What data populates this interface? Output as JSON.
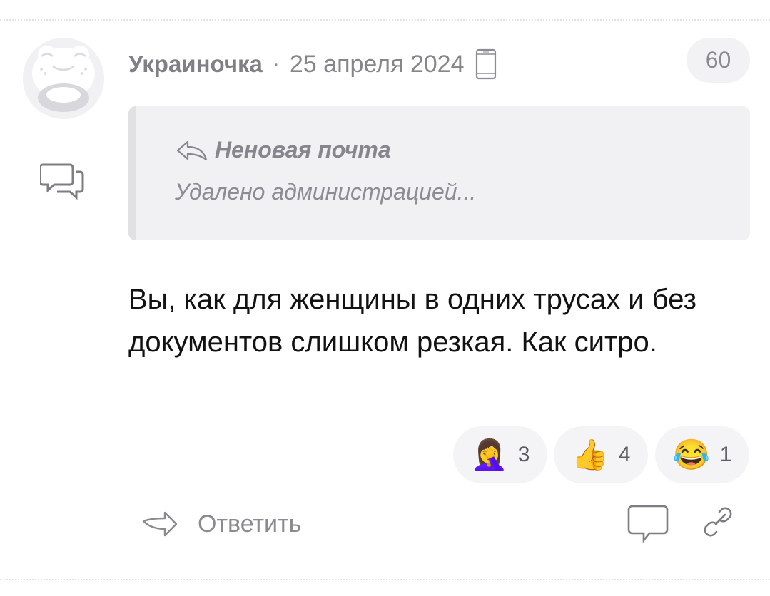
{
  "comment": {
    "author": "Украиночка",
    "separator": "·",
    "date": "25 апреля 2024",
    "score": "60",
    "quote": {
      "author": "Неновая почта",
      "text": "Удалено администрацией..."
    },
    "body": "Вы, как для женщины в одних трусах и без документов слишком резкая. Как ситро.",
    "reactions": [
      {
        "emoji": "🤦‍♀️",
        "icon": "facepalm-emoji",
        "count": "3"
      },
      {
        "emoji": "👍",
        "icon": "thumbs-up-emoji",
        "count": "4"
      },
      {
        "emoji": "😂",
        "icon": "tears-of-joy-emoji",
        "count": "1"
      }
    ],
    "actions": {
      "reply_label": "Ответить"
    }
  },
  "icons": {
    "avatar": "frog-avatar",
    "thread": "comment-thread-icon",
    "device": "mobile-phone-icon",
    "reply": "reply-arrow-icon",
    "comment": "comment-icon",
    "link": "link-icon"
  },
  "colors": {
    "muted_text": "#8c8c92",
    "quote_background": "#f1f1f3",
    "reaction_background": "#f4f4f6"
  }
}
